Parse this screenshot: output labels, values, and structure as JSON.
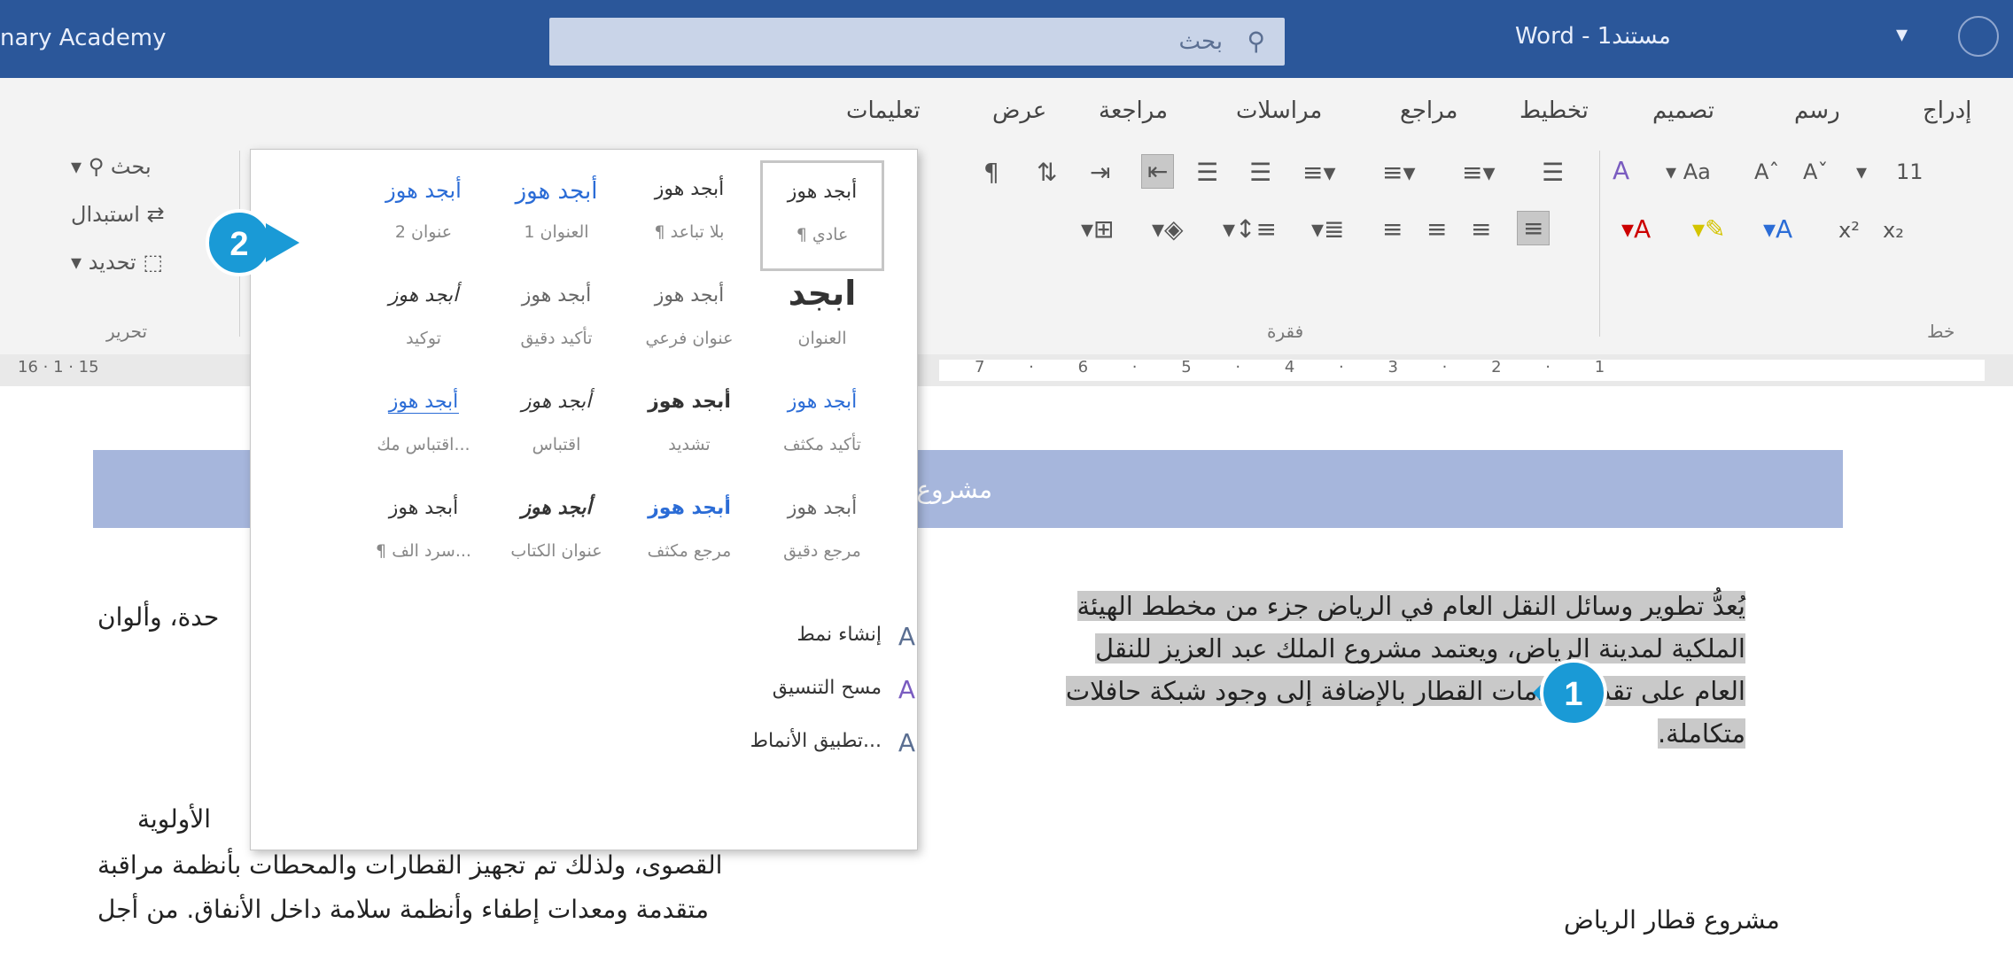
{
  "titlebar": {
    "account": "nary Academy",
    "search_label": "بحث",
    "doc_title": "Word - مستند1",
    "qa_icon": "pin-icon",
    "colors": {
      "bar": "#2b579a",
      "search": "#c9d4e8"
    }
  },
  "tabs": [
    "تعليمات",
    "عرض",
    "مراجعة",
    "مراسلات",
    "مراجع",
    "تخطيط",
    "تصميم",
    "رسم",
    "إدراج"
  ],
  "ribbon": {
    "paragraph_label": "فقرة",
    "font_label": "خط",
    "editing_label": "تحرير",
    "font_size": "11",
    "aa": "Aa",
    "editing": {
      "find": "بحث",
      "replace": "استبدال",
      "select": "تحديد"
    }
  },
  "ruler": {
    "left_numbers": "16 · 1 · 15",
    "numbers": "7 · 6 · 5 · 4 · 3 · 2 · 1"
  },
  "styles_gallery": {
    "rows": [
      [
        {
          "sample": "أبجد هوز",
          "name": "¶ عادي",
          "selected": true
        },
        {
          "sample": "أبجد هوز",
          "name": "¶ بلا تباعد"
        },
        {
          "sample": "أبجد هوز",
          "name": "العنوان 1"
        },
        {
          "sample": "أبجد هوز",
          "name": "عنوان 2"
        }
      ],
      [
        {
          "sample": "ابجد",
          "name": "العنوان"
        },
        {
          "sample": "أبجد هوز",
          "name": "عنوان فرعي"
        },
        {
          "sample": "أبجد هوز",
          "name": "تأكيد دقيق"
        },
        {
          "sample": "أبجد هوز",
          "name": "توكيد"
        }
      ],
      [
        {
          "sample": "أبجد هوز",
          "name": "تأكيد مكثف"
        },
        {
          "sample": "أبجد هوز",
          "name": "تشديد"
        },
        {
          "sample": "أبجد هوز",
          "name": "اقتباس"
        },
        {
          "sample": "أبجد هوز",
          "name": "اقتباس مك..."
        }
      ],
      [
        {
          "sample": "أبجد هوز",
          "name": "مرجع دقيق"
        },
        {
          "sample": "أبجد هوز",
          "name": "مرجع مكثف"
        },
        {
          "sample": "أبجد هوز",
          "name": "عنوان الكتاب"
        },
        {
          "sample": "أبجد هوز",
          "name": "¶ سرد الف..."
        }
      ]
    ],
    "actions": [
      "إنشاء نمط",
      "مسح التنسيق",
      "تطبيق الأنماط..."
    ]
  },
  "document": {
    "band_title": "مشروع قطار",
    "paragraph1": "يُعدُّ تطوير وسائل النقل العام في الرياض جزء من مخطط الهيئة الملكية لمدينة الرياض، ويعتمد مشروع الملك عبد العزيز للنقل العام على تقديم خدمات القطار بالإضافة إلى وجود شبكة حافلات متكاملة.",
    "left_line1": "حدة، وألوان",
    "left_priority": "الأولوية",
    "left_line2": "القصوى، ولذلك تم تجهيز القطارات والمحطات بأنظمة مراقبة",
    "left_line3": "متقدمة ومعدات إطفاء وأنظمة سلامة داخل الأنفاق. من أجل",
    "heading2": "مشروع قطار الرياض"
  },
  "callouts": {
    "one": "1",
    "two": "2",
    "color": "#1a9ad6"
  }
}
